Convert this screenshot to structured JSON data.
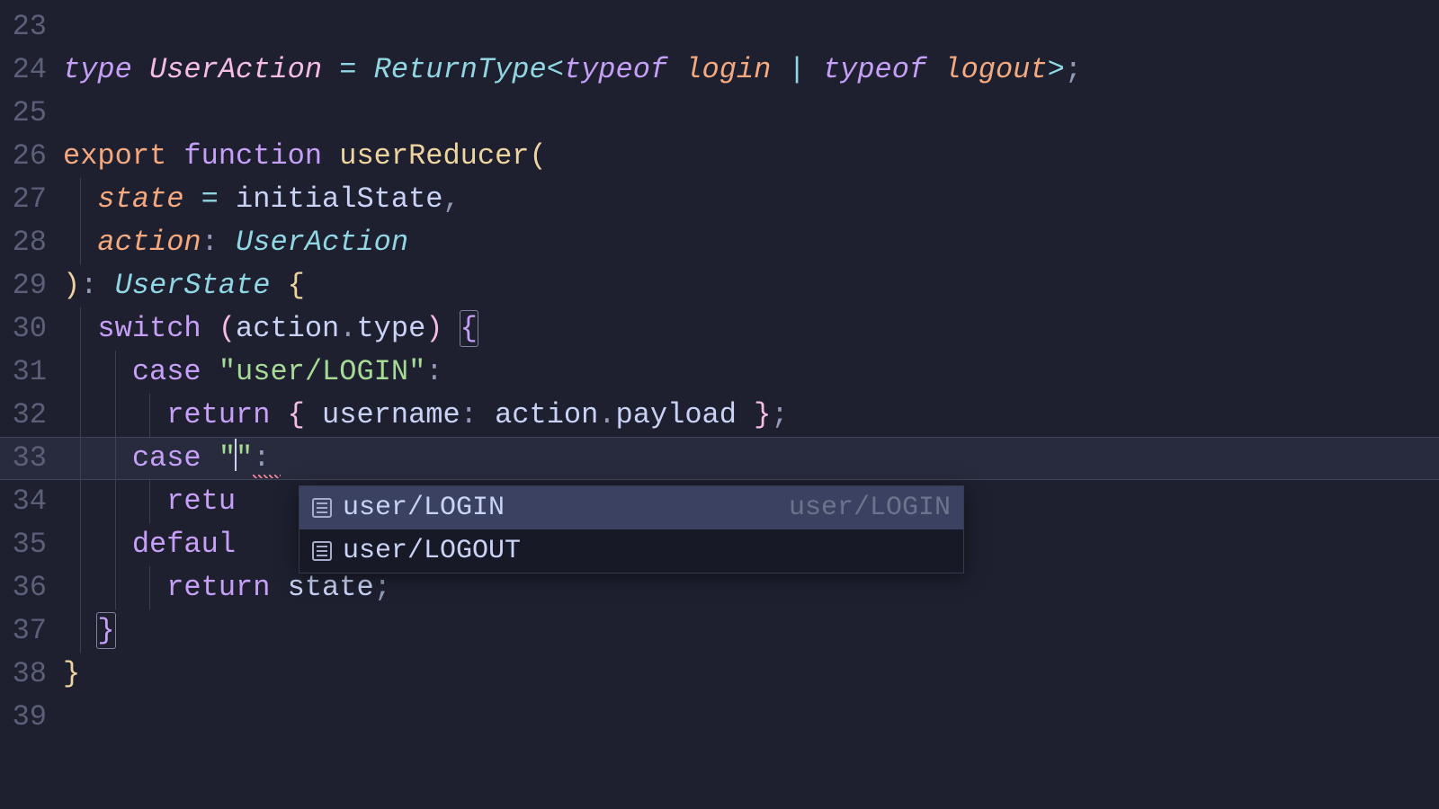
{
  "gutter": {
    "start": 23,
    "end": 39
  },
  "code": {
    "line24": {
      "type_kw": "type",
      "name": "UserAction",
      "eq": " = ",
      "rettype": "ReturnType",
      "lt": "<",
      "typeof1": "typeof",
      "sp1": " ",
      "login": "login",
      "pipe": " | ",
      "typeof2": "typeof",
      "sp2": " ",
      "logout": "logout",
      "gt": ">",
      "semi": ";"
    },
    "line26": {
      "export": "export",
      "sp": " ",
      "function": "function",
      "sp2": " ",
      "name": "userReducer",
      "paren": "("
    },
    "line27": {
      "indent": "  ",
      "param": "state",
      "eq": " = ",
      "val": "initialState",
      "comma": ","
    },
    "line28": {
      "indent": "  ",
      "param": "action",
      "colon": ": ",
      "type": "UserAction"
    },
    "line29": {
      "paren": ")",
      "colon": ": ",
      "type": "UserState",
      "sp": " ",
      "brace": "{"
    },
    "line30": {
      "indent": "  ",
      "switch": "switch",
      "sp": " ",
      "po": "(",
      "obj": "action",
      "dot": ".",
      "prop": "type",
      "pc": ")",
      "sp2": " ",
      "brace": "{"
    },
    "line31": {
      "indent": "    ",
      "case": "case",
      "sp": " ",
      "str": "\"user/LOGIN\"",
      "colon": ":"
    },
    "line32": {
      "indent": "      ",
      "return": "return",
      "sp": " ",
      "bo": "{",
      "sp2": " ",
      "prop": "username",
      "colon": ": ",
      "obj": "action",
      "dot": ".",
      "prop2": "payload",
      "sp3": " ",
      "bc": "}",
      "semi": ";"
    },
    "line33": {
      "indent": "    ",
      "case": "case",
      "sp": " ",
      "q1": "\"",
      "q2": "\"",
      "colon": ":"
    },
    "line34": {
      "indent": "      ",
      "retu": "retu"
    },
    "line35": {
      "indent": "    ",
      "defaul": "defaul"
    },
    "line36": {
      "indent": "      ",
      "return": "return",
      "sp": " ",
      "state": "state",
      "semi": ";"
    },
    "line37": {
      "indent": "  ",
      "brace": "}"
    },
    "line38": {
      "brace": "}"
    }
  },
  "autocomplete": {
    "items": [
      {
        "label": "user/LOGIN",
        "detail": "user/LOGIN",
        "selected": true
      },
      {
        "label": "user/LOGOUT",
        "detail": "",
        "selected": false
      }
    ]
  }
}
